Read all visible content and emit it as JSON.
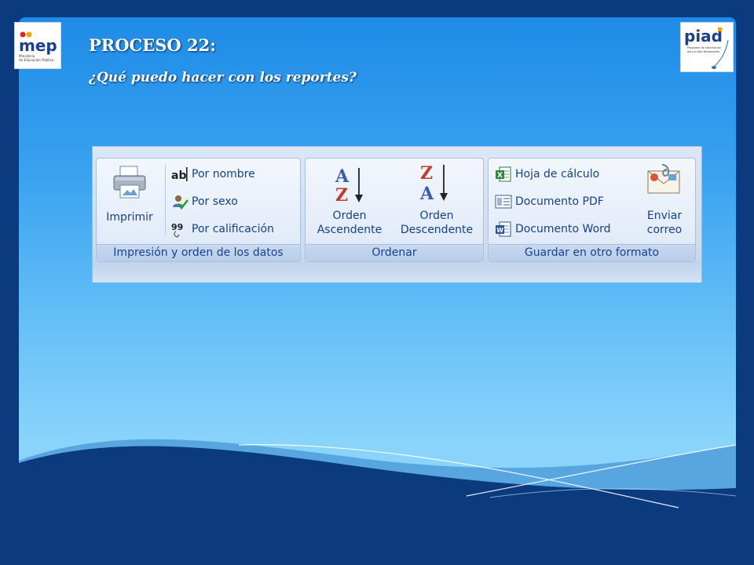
{
  "slide": {
    "title": "PROCESO 22:",
    "subtitle": "¿Qué puedo hacer con los reportes?"
  },
  "logos": {
    "left": {
      "icon": "mep-logo",
      "text_main": "mep",
      "text_sub": "Ministerio de Educación Pública"
    },
    "right": {
      "icon": "piad-logo",
      "text_main": "piad",
      "text_sub": "Programa de Información para el Alto Desempeño"
    }
  },
  "ribbon": {
    "groups": [
      {
        "label": "Impresión y orden de los datos",
        "large_button": {
          "label": "Imprimir",
          "icon": "printer-icon"
        },
        "small_buttons": [
          {
            "label": "Por nombre",
            "icon": "sort-by-name-icon"
          },
          {
            "label": "Por sexo",
            "icon": "sort-by-gender-icon"
          },
          {
            "label": "Por calificación",
            "icon": "sort-by-grade-icon"
          }
        ]
      },
      {
        "label": "Ordenar",
        "large_buttons": [
          {
            "label_line1": "Orden",
            "label_line2": "Ascendente",
            "icon": "sort-ascending-icon"
          },
          {
            "label_line1": "Orden",
            "label_line2": "Descendente",
            "icon": "sort-descending-icon"
          }
        ]
      },
      {
        "label": "Guardar en otro formato",
        "small_buttons": [
          {
            "label": "Hoja de cálculo",
            "icon": "excel-icon"
          },
          {
            "label": "Documento PDF",
            "icon": "pdf-icon"
          },
          {
            "label": "Documento Word",
            "icon": "word-icon"
          }
        ],
        "large_button": {
          "label_line1": "Enviar",
          "label_line2": "correo",
          "icon": "send-mail-icon"
        }
      }
    ]
  },
  "colors": {
    "background": "#0b3a7e",
    "panel_top": "#1e8be6",
    "panel_bottom": "#8ad4fb",
    "ribbon_text": "#15428b"
  }
}
